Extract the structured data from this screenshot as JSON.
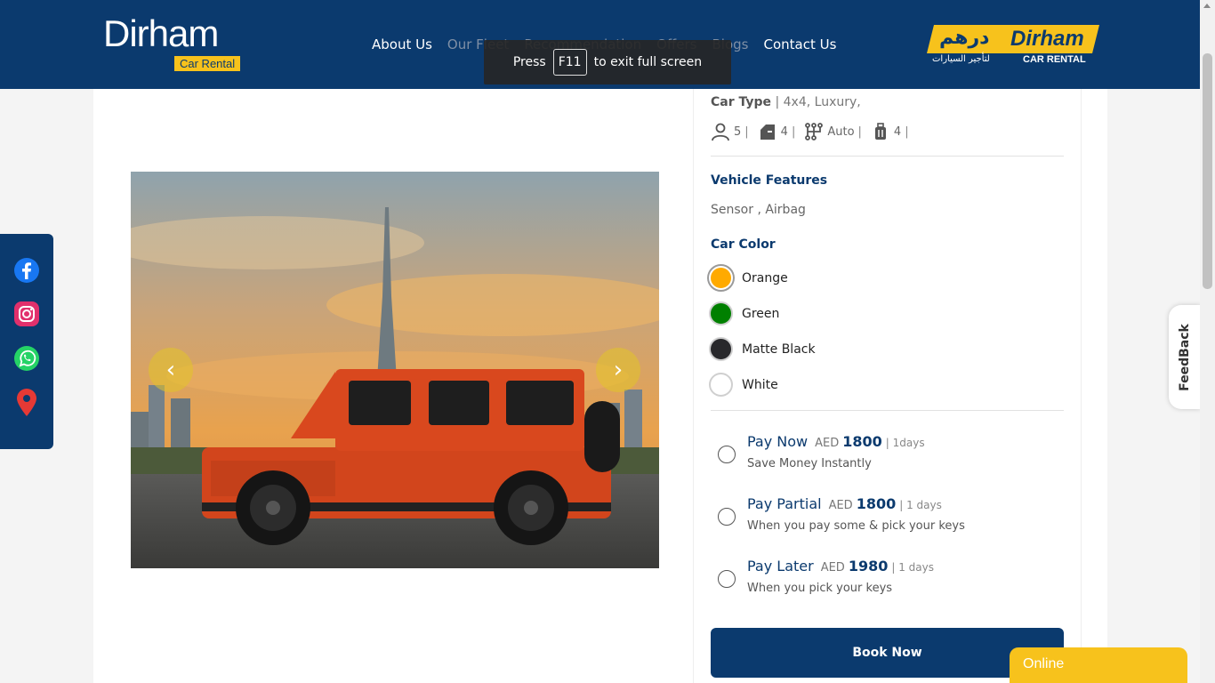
{
  "header": {
    "logo_word": "Dirham",
    "logo_tag": "Car Rental",
    "nav": [
      "About Us",
      "Our Fleet",
      "Recommendation",
      "Offers",
      "Blogs",
      "Contact Us"
    ],
    "right_logo": {
      "arabic": "درهم",
      "english": "Dirham",
      "arabic_sub": "لتأجير السيارات",
      "english_sub": "CAR RENTAL"
    }
  },
  "toast": {
    "press": "Press",
    "key": "F11",
    "message": "to exit full screen"
  },
  "car": {
    "type_label": "Car Type",
    "type_value": "| 4x4, Luxury,",
    "specs": {
      "seats": "5",
      "doors": "4",
      "transmission": "Auto",
      "luggage": "4",
      "separator": "|"
    },
    "features_heading": "Vehicle Features",
    "features_value": "Sensor , Airbag",
    "color_heading": "Car Color",
    "colors": [
      {
        "name": "Orange",
        "hex": "#ffaa00",
        "selected": true
      },
      {
        "name": "Green",
        "hex": "#008000",
        "selected": false
      },
      {
        "name": "Matte Black",
        "hex": "#28282b",
        "selected": false
      },
      {
        "name": "White",
        "hex": "#ffffff",
        "selected": false
      }
    ]
  },
  "payment": [
    {
      "title": "Pay Now",
      "currency": "AED",
      "amount": "1800",
      "days": "| 1days",
      "subtitle": "Save Money Instantly"
    },
    {
      "title": "Pay Partial",
      "currency": "AED",
      "amount": "1800",
      "days": "| 1 days",
      "subtitle": "When you pay some & pick your keys"
    },
    {
      "title": "Pay Later",
      "currency": "AED",
      "amount": "1980",
      "days": "| 1 days",
      "subtitle": "When you pick your keys"
    }
  ],
  "book_button": "Book Now",
  "feedback": "FeedBack",
  "chat": "Online",
  "social": [
    "facebook-icon",
    "instagram-icon",
    "whatsapp-icon",
    "location-pin-icon"
  ],
  "brand_colors": {
    "navy": "#0b3a6e",
    "yellow": "#f7c21c"
  }
}
